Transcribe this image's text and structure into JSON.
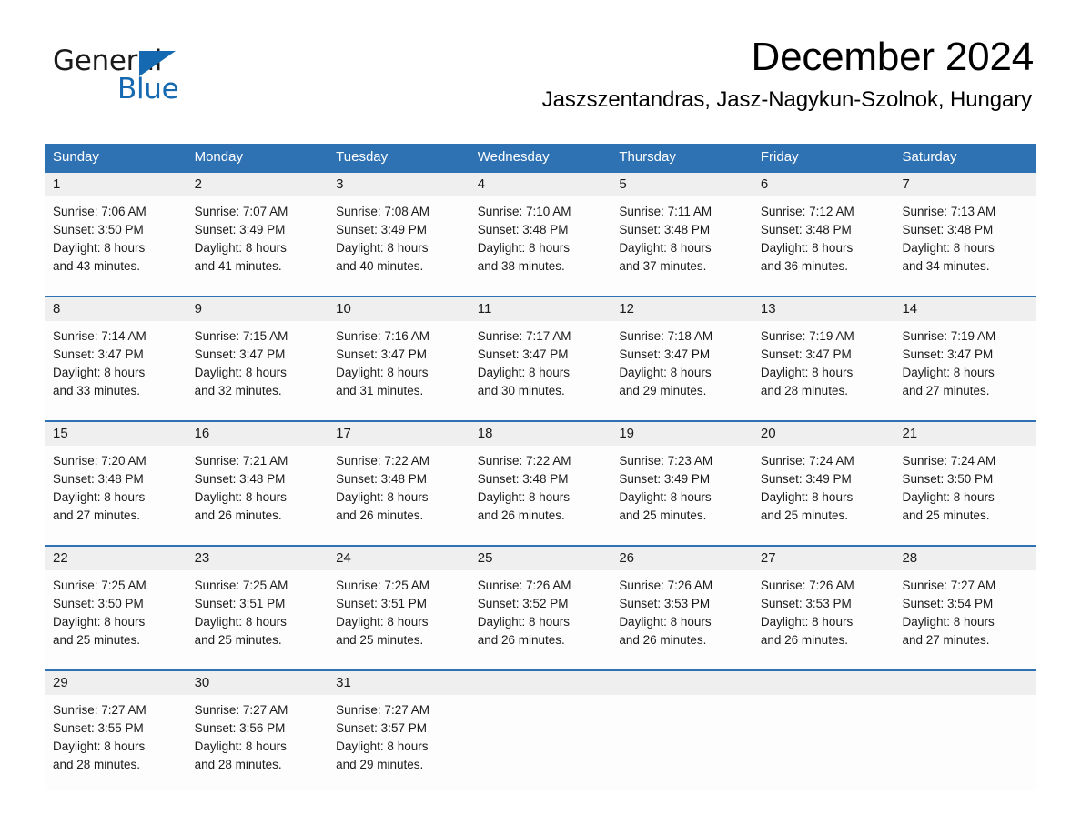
{
  "brand": {
    "word_one": "General",
    "word_two": "Blue",
    "triangle_icon": "right-triangle-icon",
    "accent_color": "#1569b0"
  },
  "header": {
    "title": "December 2024",
    "subtitle": "Jaszszentandras, Jasz-Nagykun-Szolnok, Hungary"
  },
  "calendar": {
    "header_bg": "#2f72b4",
    "header_text_color": "#ffffff",
    "daynum_band_bg": "#efefef",
    "row_divider_color": "#2f72b4",
    "weekday_headers": [
      "Sunday",
      "Monday",
      "Tuesday",
      "Wednesday",
      "Thursday",
      "Friday",
      "Saturday"
    ],
    "weeks": [
      {
        "days": [
          {
            "date": "1",
            "sunrise": "Sunrise: 7:06 AM",
            "sunset": "Sunset: 3:50 PM",
            "daylight_line1": "Daylight: 8 hours",
            "daylight_line2": "and 43 minutes."
          },
          {
            "date": "2",
            "sunrise": "Sunrise: 7:07 AM",
            "sunset": "Sunset: 3:49 PM",
            "daylight_line1": "Daylight: 8 hours",
            "daylight_line2": "and 41 minutes."
          },
          {
            "date": "3",
            "sunrise": "Sunrise: 7:08 AM",
            "sunset": "Sunset: 3:49 PM",
            "daylight_line1": "Daylight: 8 hours",
            "daylight_line2": "and 40 minutes."
          },
          {
            "date": "4",
            "sunrise": "Sunrise: 7:10 AM",
            "sunset": "Sunset: 3:48 PM",
            "daylight_line1": "Daylight: 8 hours",
            "daylight_line2": "and 38 minutes."
          },
          {
            "date": "5",
            "sunrise": "Sunrise: 7:11 AM",
            "sunset": "Sunset: 3:48 PM",
            "daylight_line1": "Daylight: 8 hours",
            "daylight_line2": "and 37 minutes."
          },
          {
            "date": "6",
            "sunrise": "Sunrise: 7:12 AM",
            "sunset": "Sunset: 3:48 PM",
            "daylight_line1": "Daylight: 8 hours",
            "daylight_line2": "and 36 minutes."
          },
          {
            "date": "7",
            "sunrise": "Sunrise: 7:13 AM",
            "sunset": "Sunset: 3:48 PM",
            "daylight_line1": "Daylight: 8 hours",
            "daylight_line2": "and 34 minutes."
          }
        ]
      },
      {
        "days": [
          {
            "date": "8",
            "sunrise": "Sunrise: 7:14 AM",
            "sunset": "Sunset: 3:47 PM",
            "daylight_line1": "Daylight: 8 hours",
            "daylight_line2": "and 33 minutes."
          },
          {
            "date": "9",
            "sunrise": "Sunrise: 7:15 AM",
            "sunset": "Sunset: 3:47 PM",
            "daylight_line1": "Daylight: 8 hours",
            "daylight_line2": "and 32 minutes."
          },
          {
            "date": "10",
            "sunrise": "Sunrise: 7:16 AM",
            "sunset": "Sunset: 3:47 PM",
            "daylight_line1": "Daylight: 8 hours",
            "daylight_line2": "and 31 minutes."
          },
          {
            "date": "11",
            "sunrise": "Sunrise: 7:17 AM",
            "sunset": "Sunset: 3:47 PM",
            "daylight_line1": "Daylight: 8 hours",
            "daylight_line2": "and 30 minutes."
          },
          {
            "date": "12",
            "sunrise": "Sunrise: 7:18 AM",
            "sunset": "Sunset: 3:47 PM",
            "daylight_line1": "Daylight: 8 hours",
            "daylight_line2": "and 29 minutes."
          },
          {
            "date": "13",
            "sunrise": "Sunrise: 7:19 AM",
            "sunset": "Sunset: 3:47 PM",
            "daylight_line1": "Daylight: 8 hours",
            "daylight_line2": "and 28 minutes."
          },
          {
            "date": "14",
            "sunrise": "Sunrise: 7:19 AM",
            "sunset": "Sunset: 3:47 PM",
            "daylight_line1": "Daylight: 8 hours",
            "daylight_line2": "and 27 minutes."
          }
        ]
      },
      {
        "days": [
          {
            "date": "15",
            "sunrise": "Sunrise: 7:20 AM",
            "sunset": "Sunset: 3:48 PM",
            "daylight_line1": "Daylight: 8 hours",
            "daylight_line2": "and 27 minutes."
          },
          {
            "date": "16",
            "sunrise": "Sunrise: 7:21 AM",
            "sunset": "Sunset: 3:48 PM",
            "daylight_line1": "Daylight: 8 hours",
            "daylight_line2": "and 26 minutes."
          },
          {
            "date": "17",
            "sunrise": "Sunrise: 7:22 AM",
            "sunset": "Sunset: 3:48 PM",
            "daylight_line1": "Daylight: 8 hours",
            "daylight_line2": "and 26 minutes."
          },
          {
            "date": "18",
            "sunrise": "Sunrise: 7:22 AM",
            "sunset": "Sunset: 3:48 PM",
            "daylight_line1": "Daylight: 8 hours",
            "daylight_line2": "and 26 minutes."
          },
          {
            "date": "19",
            "sunrise": "Sunrise: 7:23 AM",
            "sunset": "Sunset: 3:49 PM",
            "daylight_line1": "Daylight: 8 hours",
            "daylight_line2": "and 25 minutes."
          },
          {
            "date": "20",
            "sunrise": "Sunrise: 7:24 AM",
            "sunset": "Sunset: 3:49 PM",
            "daylight_line1": "Daylight: 8 hours",
            "daylight_line2": "and 25 minutes."
          },
          {
            "date": "21",
            "sunrise": "Sunrise: 7:24 AM",
            "sunset": "Sunset: 3:50 PM",
            "daylight_line1": "Daylight: 8 hours",
            "daylight_line2": "and 25 minutes."
          }
        ]
      },
      {
        "days": [
          {
            "date": "22",
            "sunrise": "Sunrise: 7:25 AM",
            "sunset": "Sunset: 3:50 PM",
            "daylight_line1": "Daylight: 8 hours",
            "daylight_line2": "and 25 minutes."
          },
          {
            "date": "23",
            "sunrise": "Sunrise: 7:25 AM",
            "sunset": "Sunset: 3:51 PM",
            "daylight_line1": "Daylight: 8 hours",
            "daylight_line2": "and 25 minutes."
          },
          {
            "date": "24",
            "sunrise": "Sunrise: 7:25 AM",
            "sunset": "Sunset: 3:51 PM",
            "daylight_line1": "Daylight: 8 hours",
            "daylight_line2": "and 25 minutes."
          },
          {
            "date": "25",
            "sunrise": "Sunrise: 7:26 AM",
            "sunset": "Sunset: 3:52 PM",
            "daylight_line1": "Daylight: 8 hours",
            "daylight_line2": "and 26 minutes."
          },
          {
            "date": "26",
            "sunrise": "Sunrise: 7:26 AM",
            "sunset": "Sunset: 3:53 PM",
            "daylight_line1": "Daylight: 8 hours",
            "daylight_line2": "and 26 minutes."
          },
          {
            "date": "27",
            "sunrise": "Sunrise: 7:26 AM",
            "sunset": "Sunset: 3:53 PM",
            "daylight_line1": "Daylight: 8 hours",
            "daylight_line2": "and 26 minutes."
          },
          {
            "date": "28",
            "sunrise": "Sunrise: 7:27 AM",
            "sunset": "Sunset: 3:54 PM",
            "daylight_line1": "Daylight: 8 hours",
            "daylight_line2": "and 27 minutes."
          }
        ]
      },
      {
        "days": [
          {
            "date": "29",
            "sunrise": "Sunrise: 7:27 AM",
            "sunset": "Sunset: 3:55 PM",
            "daylight_line1": "Daylight: 8 hours",
            "daylight_line2": "and 28 minutes."
          },
          {
            "date": "30",
            "sunrise": "Sunrise: 7:27 AM",
            "sunset": "Sunset: 3:56 PM",
            "daylight_line1": "Daylight: 8 hours",
            "daylight_line2": "and 28 minutes."
          },
          {
            "date": "31",
            "sunrise": "Sunrise: 7:27 AM",
            "sunset": "Sunset: 3:57 PM",
            "daylight_line1": "Daylight: 8 hours",
            "daylight_line2": "and 29 minutes."
          },
          {
            "date": "",
            "sunrise": "",
            "sunset": "",
            "daylight_line1": "",
            "daylight_line2": ""
          },
          {
            "date": "",
            "sunrise": "",
            "sunset": "",
            "daylight_line1": "",
            "daylight_line2": ""
          },
          {
            "date": "",
            "sunrise": "",
            "sunset": "",
            "daylight_line1": "",
            "daylight_line2": ""
          },
          {
            "date": "",
            "sunrise": "",
            "sunset": "",
            "daylight_line1": "",
            "daylight_line2": ""
          }
        ]
      }
    ]
  }
}
